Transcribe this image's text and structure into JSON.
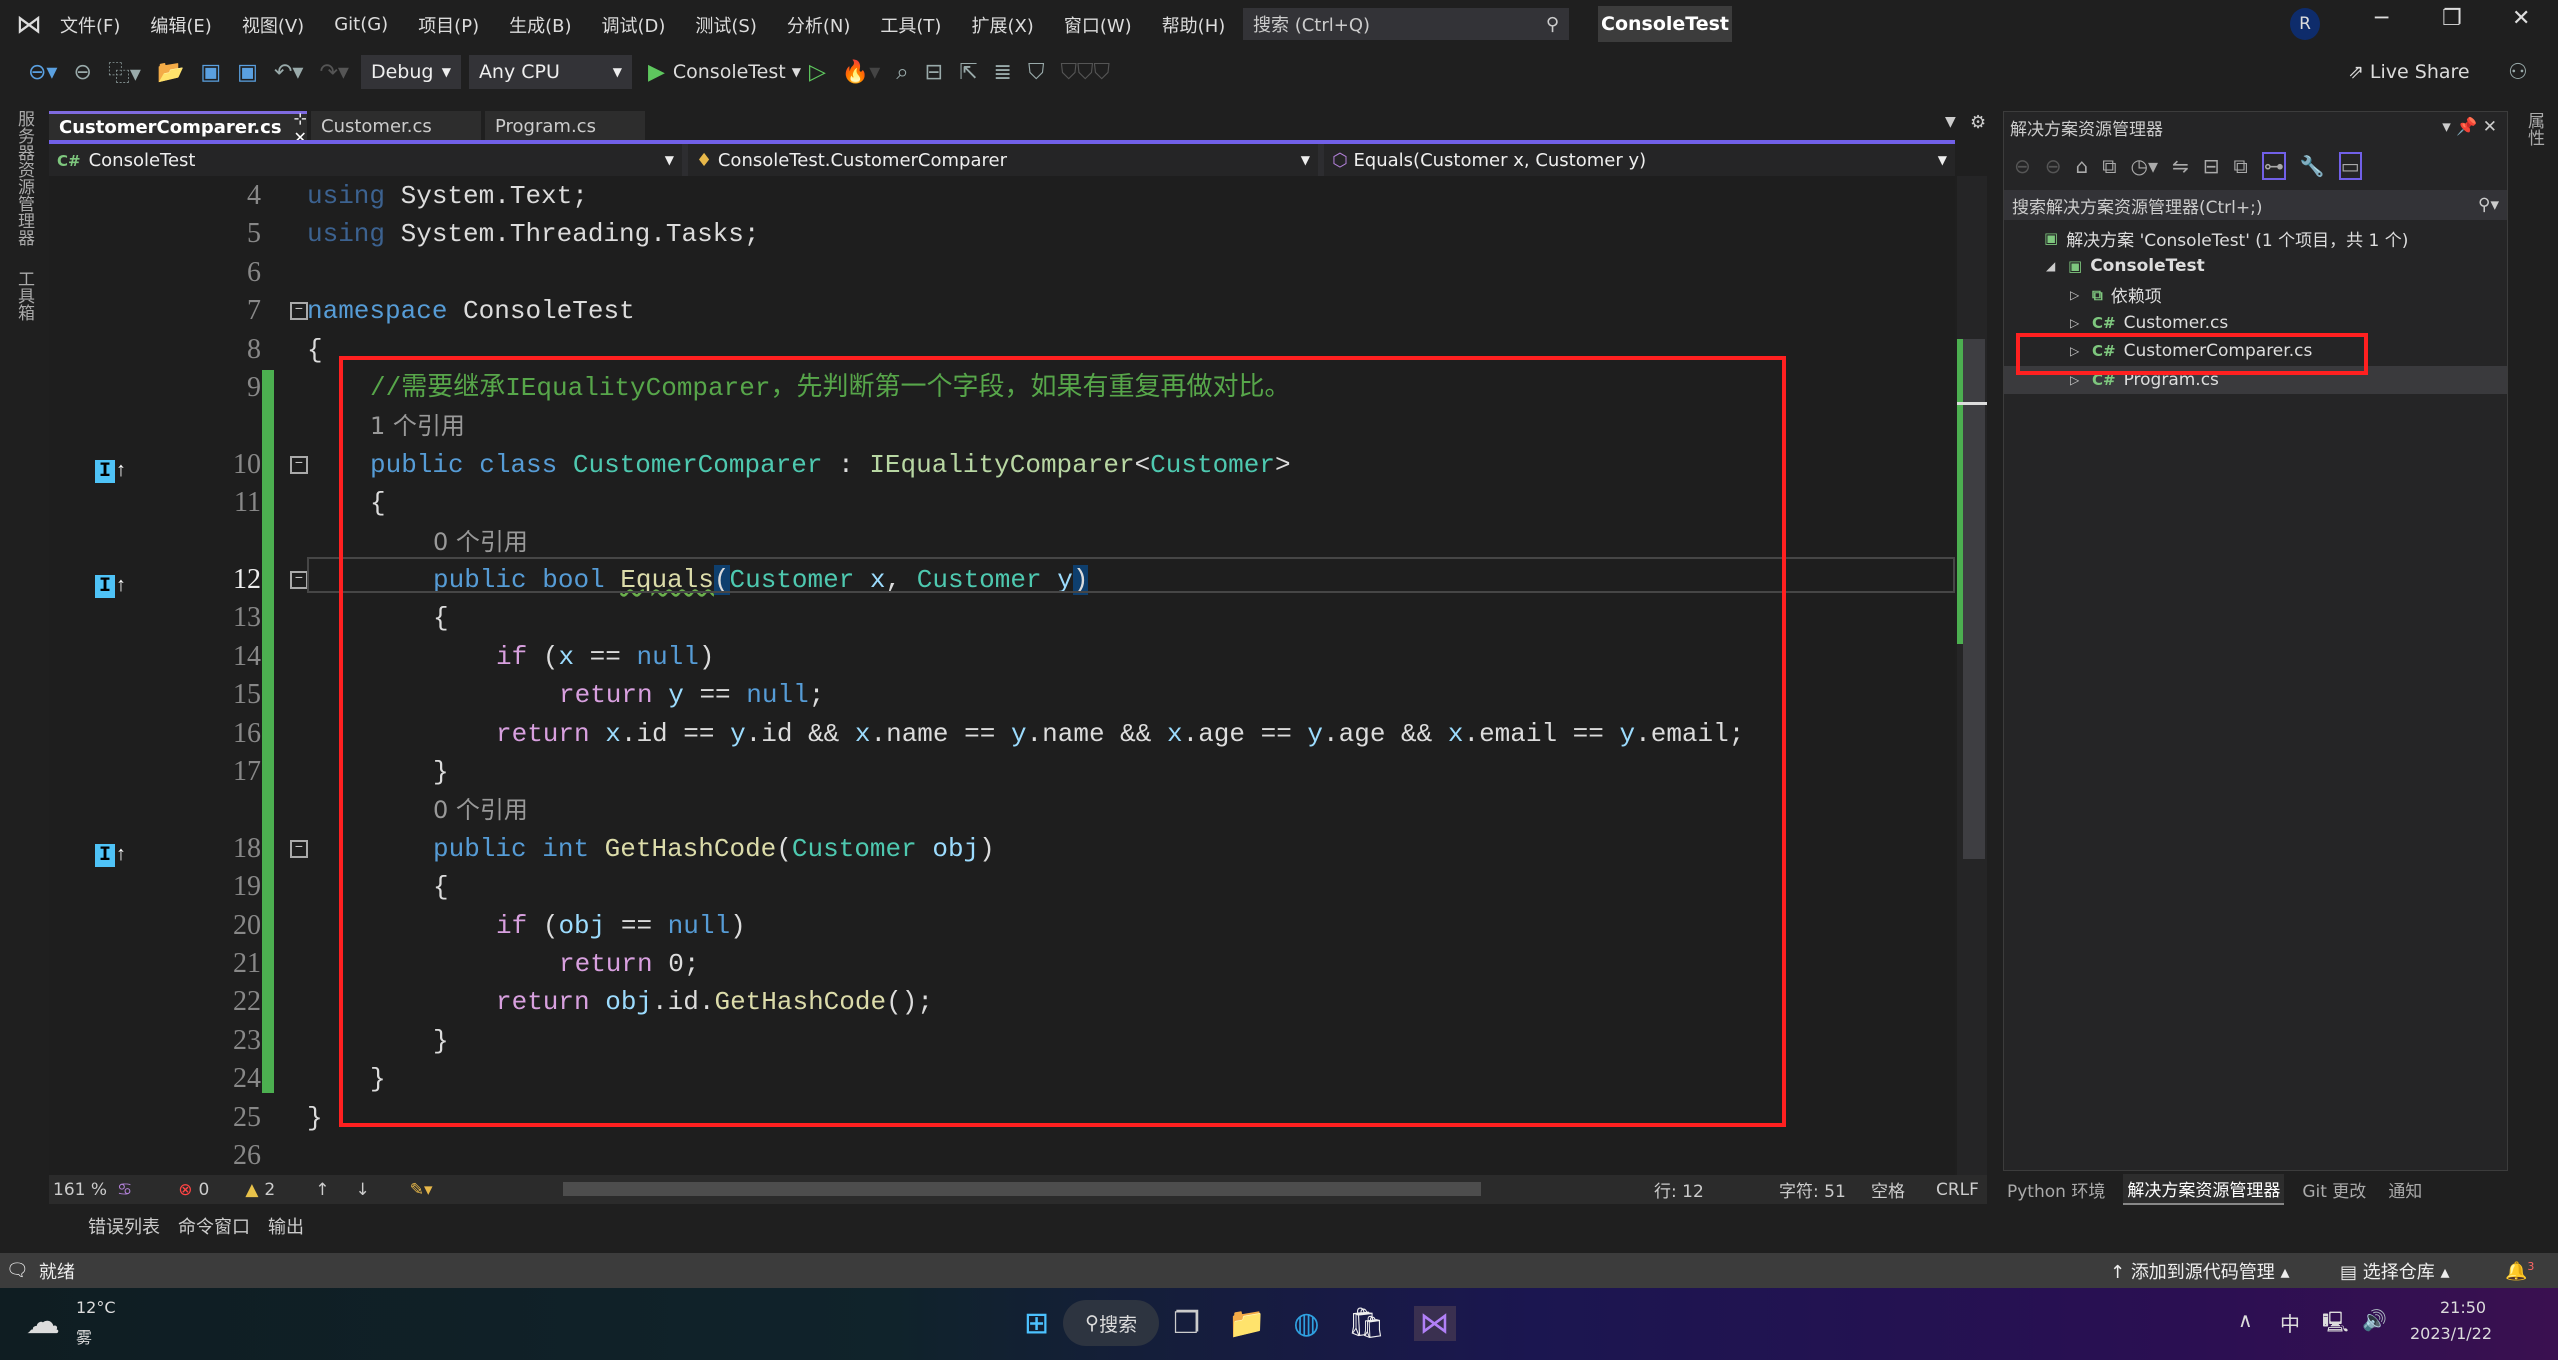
{
  "title": {
    "menus": [
      "文件(F)",
      "编辑(E)",
      "视图(V)",
      "Git(G)",
      "项目(P)",
      "生成(B)",
      "调试(D)",
      "测试(S)",
      "分析(N)",
      "工具(T)",
      "扩展(X)",
      "窗口(W)",
      "帮助(H)"
    ],
    "search_placeholder": "搜索 (Ctrl+Q)",
    "solution_badge": "ConsoleTest",
    "avatar": "R"
  },
  "toolbar": {
    "config": "Debug",
    "platform": "Any CPU",
    "run_target": "ConsoleTest",
    "live_share": "Live Share"
  },
  "side": {
    "left": [
      "服务器资源管理器",
      "工具箱"
    ],
    "right": "属性"
  },
  "tabs": [
    {
      "label": "CustomerComparer.cs",
      "active": true
    },
    {
      "label": "Customer.cs"
    },
    {
      "label": "Program.cs"
    }
  ],
  "nav": {
    "project": "ConsoleTest",
    "class": "ConsoleTest.CustomerComparer",
    "member": "Equals(Customer x, Customer y)"
  },
  "code": [
    {
      "n": "4",
      "t": [
        [
          "kwd",
          "using"
        ],
        [
          "pl",
          " System.Text;"
        ]
      ]
    },
    {
      "n": "5",
      "t": [
        [
          "kwd",
          "using"
        ],
        [
          "pl",
          " System.Threading.Tasks;"
        ]
      ]
    },
    {
      "n": "6",
      "t": []
    },
    {
      "n": "7",
      "fold": true,
      "t": [
        [
          "kw",
          "namespace"
        ],
        [
          "pl",
          " ConsoleTest"
        ]
      ]
    },
    {
      "n": "8",
      "t": [
        [
          "pl",
          "{"
        ]
      ]
    },
    {
      "n": "9",
      "i": 1,
      "t": [
        [
          "cm",
          "//需要继承IEqualityComparer，先判断第一个字段，如果有重复再做对比。"
        ]
      ]
    },
    {
      "lens": "1 个引用",
      "i": 1
    },
    {
      "n": "10",
      "i": 1,
      "fold": true,
      "mark": true,
      "t": [
        [
          "kw",
          "public"
        ],
        [
          "pl",
          " "
        ],
        [
          "kw",
          "class"
        ],
        [
          "pl",
          " "
        ],
        [
          "ty",
          "CustomerComparer"
        ],
        [
          "pl",
          " : "
        ],
        [
          "if",
          "IEqualityComparer"
        ],
        [
          "pl",
          "<"
        ],
        [
          "ty",
          "Customer"
        ],
        [
          "pl",
          ">"
        ]
      ]
    },
    {
      "n": "11",
      "i": 1,
      "t": [
        [
          "pl",
          "{"
        ]
      ]
    },
    {
      "lens": "0 个引用",
      "i": 2
    },
    {
      "n": "12",
      "i": 2,
      "fold": true,
      "mark": true,
      "cur": true,
      "t": [
        [
          "kw",
          "public"
        ],
        [
          "pl",
          " "
        ],
        [
          "kw",
          "bool"
        ],
        [
          "pl",
          " "
        ],
        [
          "me sq",
          "Equals"
        ],
        [
          "pl hl",
          "("
        ],
        [
          "ty",
          "Customer"
        ],
        [
          "va",
          " x"
        ],
        [
          "pl",
          ", "
        ],
        [
          "ty",
          "Customer"
        ],
        [
          "va",
          " y"
        ],
        [
          "pl hl",
          ")"
        ]
      ]
    },
    {
      "n": "13",
      "i": 2,
      "t": [
        [
          "pl",
          "{"
        ]
      ]
    },
    {
      "n": "14",
      "i": 3,
      "t": [
        [
          "ctl",
          "if"
        ],
        [
          "pl",
          " ("
        ],
        [
          "va",
          "x"
        ],
        [
          "pl",
          " == "
        ],
        [
          "kw",
          "null"
        ],
        [
          "pl",
          ")"
        ]
      ]
    },
    {
      "n": "15",
      "i": 4,
      "t": [
        [
          "ctl",
          "return"
        ],
        [
          "va",
          " y"
        ],
        [
          "pl",
          " == "
        ],
        [
          "kw",
          "null"
        ],
        [
          "pl",
          ";"
        ]
      ]
    },
    {
      "n": "16",
      "i": 3,
      "t": [
        [
          "ctl",
          "return"
        ],
        [
          "va",
          " x"
        ],
        [
          "pl",
          ".id == "
        ],
        [
          "va",
          "y"
        ],
        [
          "pl",
          ".id && "
        ],
        [
          "va",
          "x"
        ],
        [
          "pl",
          ".name == "
        ],
        [
          "va",
          "y"
        ],
        [
          "pl",
          ".name && "
        ],
        [
          "va",
          "x"
        ],
        [
          "pl",
          ".age == "
        ],
        [
          "va",
          "y"
        ],
        [
          "pl",
          ".age && "
        ],
        [
          "va",
          "x"
        ],
        [
          "pl",
          ".email == "
        ],
        [
          "va",
          "y"
        ],
        [
          "pl",
          ".email;"
        ]
      ]
    },
    {
      "n": "17",
      "i": 2,
      "t": [
        [
          "pl",
          "}"
        ]
      ]
    },
    {
      "lens": "0 个引用",
      "i": 2
    },
    {
      "n": "18",
      "i": 2,
      "fold": true,
      "mark": true,
      "t": [
        [
          "kw",
          "public"
        ],
        [
          "pl",
          " "
        ],
        [
          "kw",
          "int"
        ],
        [
          "pl",
          " "
        ],
        [
          "me",
          "GetHashCode"
        ],
        [
          "pl",
          "("
        ],
        [
          "ty",
          "Customer"
        ],
        [
          "va",
          " obj"
        ],
        [
          "pl",
          ")"
        ]
      ]
    },
    {
      "n": "19",
      "i": 2,
      "t": [
        [
          "pl",
          "{"
        ]
      ]
    },
    {
      "n": "20",
      "i": 3,
      "t": [
        [
          "ctl",
          "if"
        ],
        [
          "pl",
          " ("
        ],
        [
          "va",
          "obj"
        ],
        [
          "pl",
          " == "
        ],
        [
          "kw",
          "null"
        ],
        [
          "pl",
          ")"
        ]
      ]
    },
    {
      "n": "21",
      "i": 4,
      "t": [
        [
          "ctl",
          "return"
        ],
        [
          "pl",
          " 0;"
        ]
      ]
    },
    {
      "n": "22",
      "i": 3,
      "t": [
        [
          "ctl",
          "return"
        ],
        [
          "va",
          " obj"
        ],
        [
          "pl",
          ".id."
        ],
        [
          "me",
          "GetHashCode"
        ],
        [
          "pl",
          "();"
        ]
      ]
    },
    {
      "n": "23",
      "i": 2,
      "t": [
        [
          "pl",
          "}"
        ]
      ]
    },
    {
      "n": "24",
      "i": 1,
      "t": [
        [
          "pl",
          "}"
        ]
      ]
    },
    {
      "n": "25",
      "t": [
        [
          "pl",
          "}"
        ]
      ]
    },
    {
      "n": "26",
      "t": []
    }
  ],
  "editor_status": {
    "zoom": "161 %",
    "errors": "0",
    "warnings": "2",
    "line": "行: 12",
    "char": "字符: 51",
    "spaces": "空格",
    "eol": "CRLF"
  },
  "solution": {
    "title": "解决方案资源管理器",
    "search": "搜索解决方案资源管理器(Ctrl+;)",
    "tree": [
      {
        "label": "解决方案 'ConsoleTest' (1 个项目，共 1 个)",
        "level": 0
      },
      {
        "label": "ConsoleTest",
        "level": 1,
        "bold": true
      },
      {
        "label": "依赖项",
        "level": 2
      },
      {
        "label": "Customer.cs",
        "level": 2,
        "cs": true
      },
      {
        "label": "CustomerComparer.cs",
        "level": 2,
        "cs": true
      },
      {
        "label": "Program.cs",
        "level": 2,
        "cs": true,
        "selected": true
      }
    ],
    "tabs": [
      "Python 环境",
      "解决方案资源管理器",
      "Git 更改",
      "通知"
    ]
  },
  "bottom_tabs": [
    "错误列表",
    "命令窗口",
    "输出"
  ],
  "statusbar": {
    "ready": "就绪",
    "add_source": "添加到源代码管理",
    "select_repo": "选择仓库",
    "notif_count": "3"
  },
  "taskbar": {
    "temp": "12°C",
    "weather": "雾",
    "search": "搜索",
    "ime": "中",
    "time": "21:50",
    "date": "2023/1/22"
  },
  "colors": {
    "accent": "#7160e8",
    "highlight_box": "#ff2020",
    "change_bar": "#4caf50"
  }
}
